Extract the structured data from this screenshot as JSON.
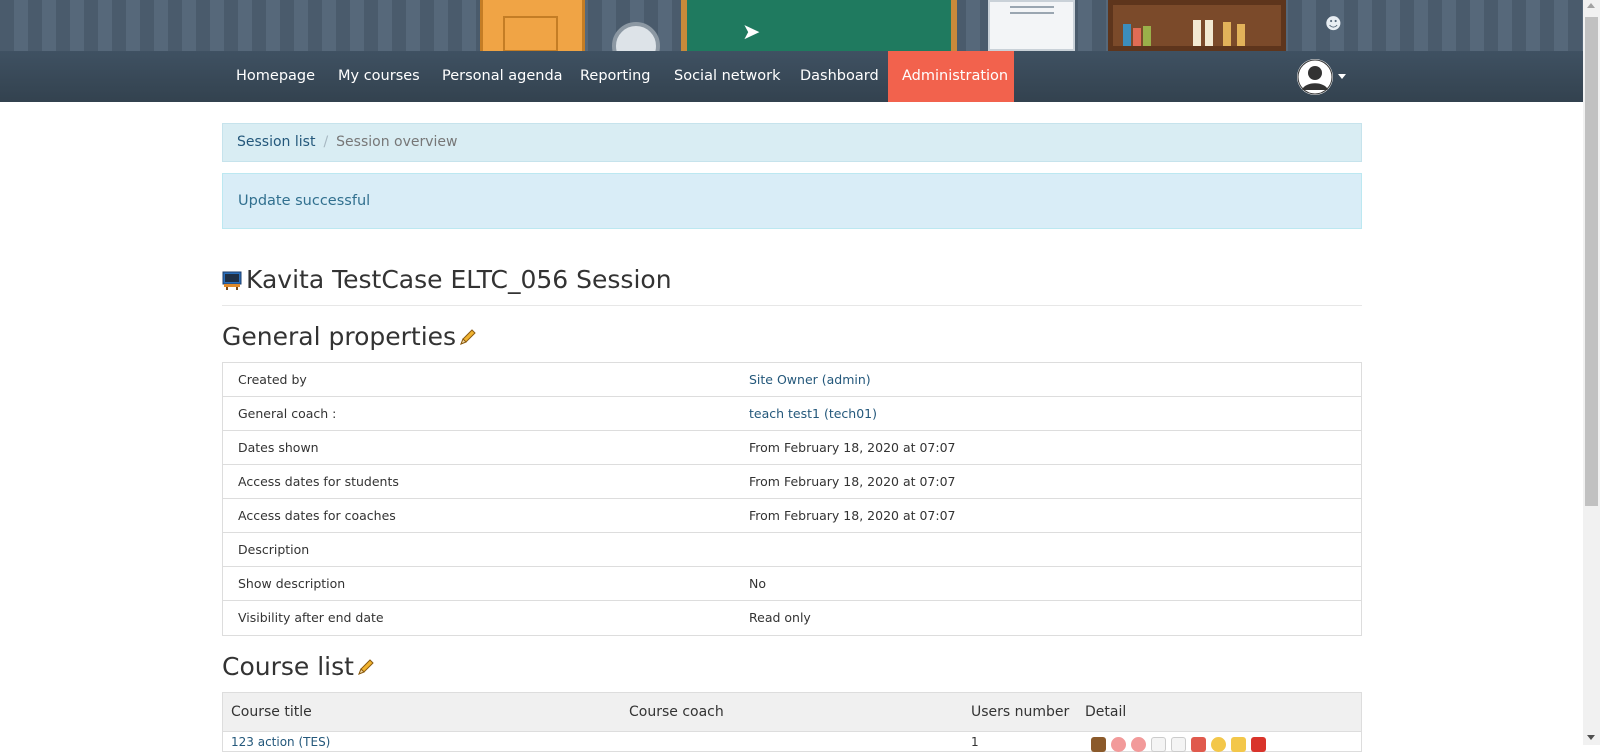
{
  "nav": {
    "items": [
      {
        "label": "Homepage"
      },
      {
        "label": "My courses"
      },
      {
        "label": "Personal agenda"
      },
      {
        "label": "Reporting"
      },
      {
        "label": "Social network"
      },
      {
        "label": "Dashboard"
      },
      {
        "label": "Administration",
        "active": true
      }
    ],
    "accent_color": "#f2624d"
  },
  "breadcrumb": {
    "link": "Session list",
    "separator": "/",
    "current": "Session overview"
  },
  "alert": {
    "message": "Update successful"
  },
  "session": {
    "title": "Kavita TestCase ELTC_056 Session"
  },
  "general_properties": {
    "heading": "General properties",
    "rows": [
      {
        "label": "Created by",
        "value": "Site Owner (admin)"
      },
      {
        "label": "General coach :",
        "value": "teach test1 (tech01)"
      },
      {
        "label": "Dates shown",
        "value": "From February 18, 2020 at 07:07"
      },
      {
        "label": "Access dates for students",
        "value": "From February 18, 2020 at 07:07"
      },
      {
        "label": "Access dates for coaches",
        "value": "From February 18, 2020 at 07:07"
      },
      {
        "label": "Description",
        "value": ""
      },
      {
        "label": "Show description",
        "value": "No"
      },
      {
        "label": "Visibility after end date",
        "value": "Read only"
      }
    ]
  },
  "course_list": {
    "heading": "Course list",
    "columns": [
      "Course title",
      "Course coach",
      "Users number",
      "Detail"
    ],
    "rows": [
      {
        "title": "123 action (TES)",
        "coach": "",
        "users": "1"
      }
    ]
  }
}
